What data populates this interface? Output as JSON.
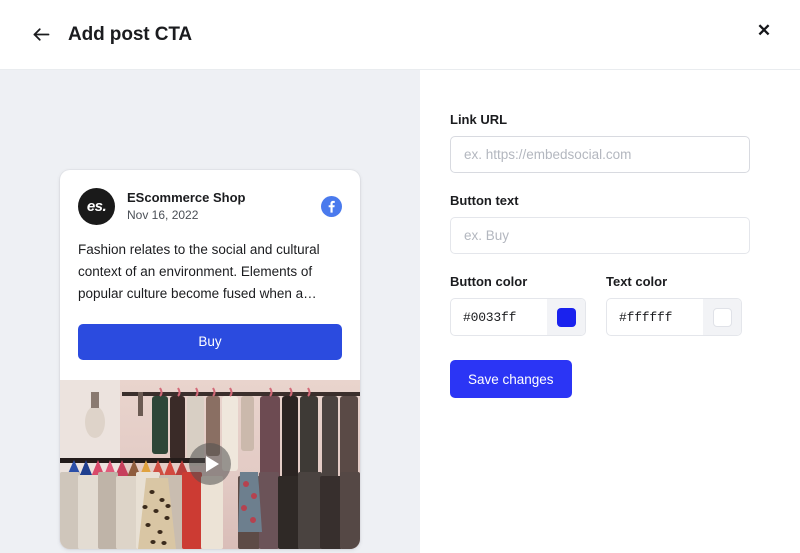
{
  "header": {
    "title": "Add post CTA",
    "back_icon": "arrow-left-icon",
    "close_label": "✕"
  },
  "preview": {
    "avatar_text": "es.",
    "author": "EScommerce Shop",
    "date": "Nov 16, 2022",
    "network_icon": "facebook-icon",
    "post_text": "Fashion relates to the social and cultural context of an environment. Elements of popular culture become fused when a…",
    "cta_label": "Buy",
    "cta_bg": "#2b4bdf",
    "cta_color": "#ffffff",
    "media_type": "video",
    "play_icon": "play-icon"
  },
  "form": {
    "link_url": {
      "label": "Link URL",
      "value": "",
      "placeholder": "ex. https://embedsocial.com"
    },
    "button_text": {
      "label": "Button text",
      "value": "",
      "placeholder": "ex. Buy"
    },
    "button_color": {
      "label": "Button color",
      "value": "#0033ff",
      "swatch": "#1a22ee"
    },
    "text_color": {
      "label": "Text color",
      "value": "#ffffff",
      "swatch": "#ffffff"
    },
    "save_label": "Save changes",
    "save_bg": "#2b35f5"
  }
}
